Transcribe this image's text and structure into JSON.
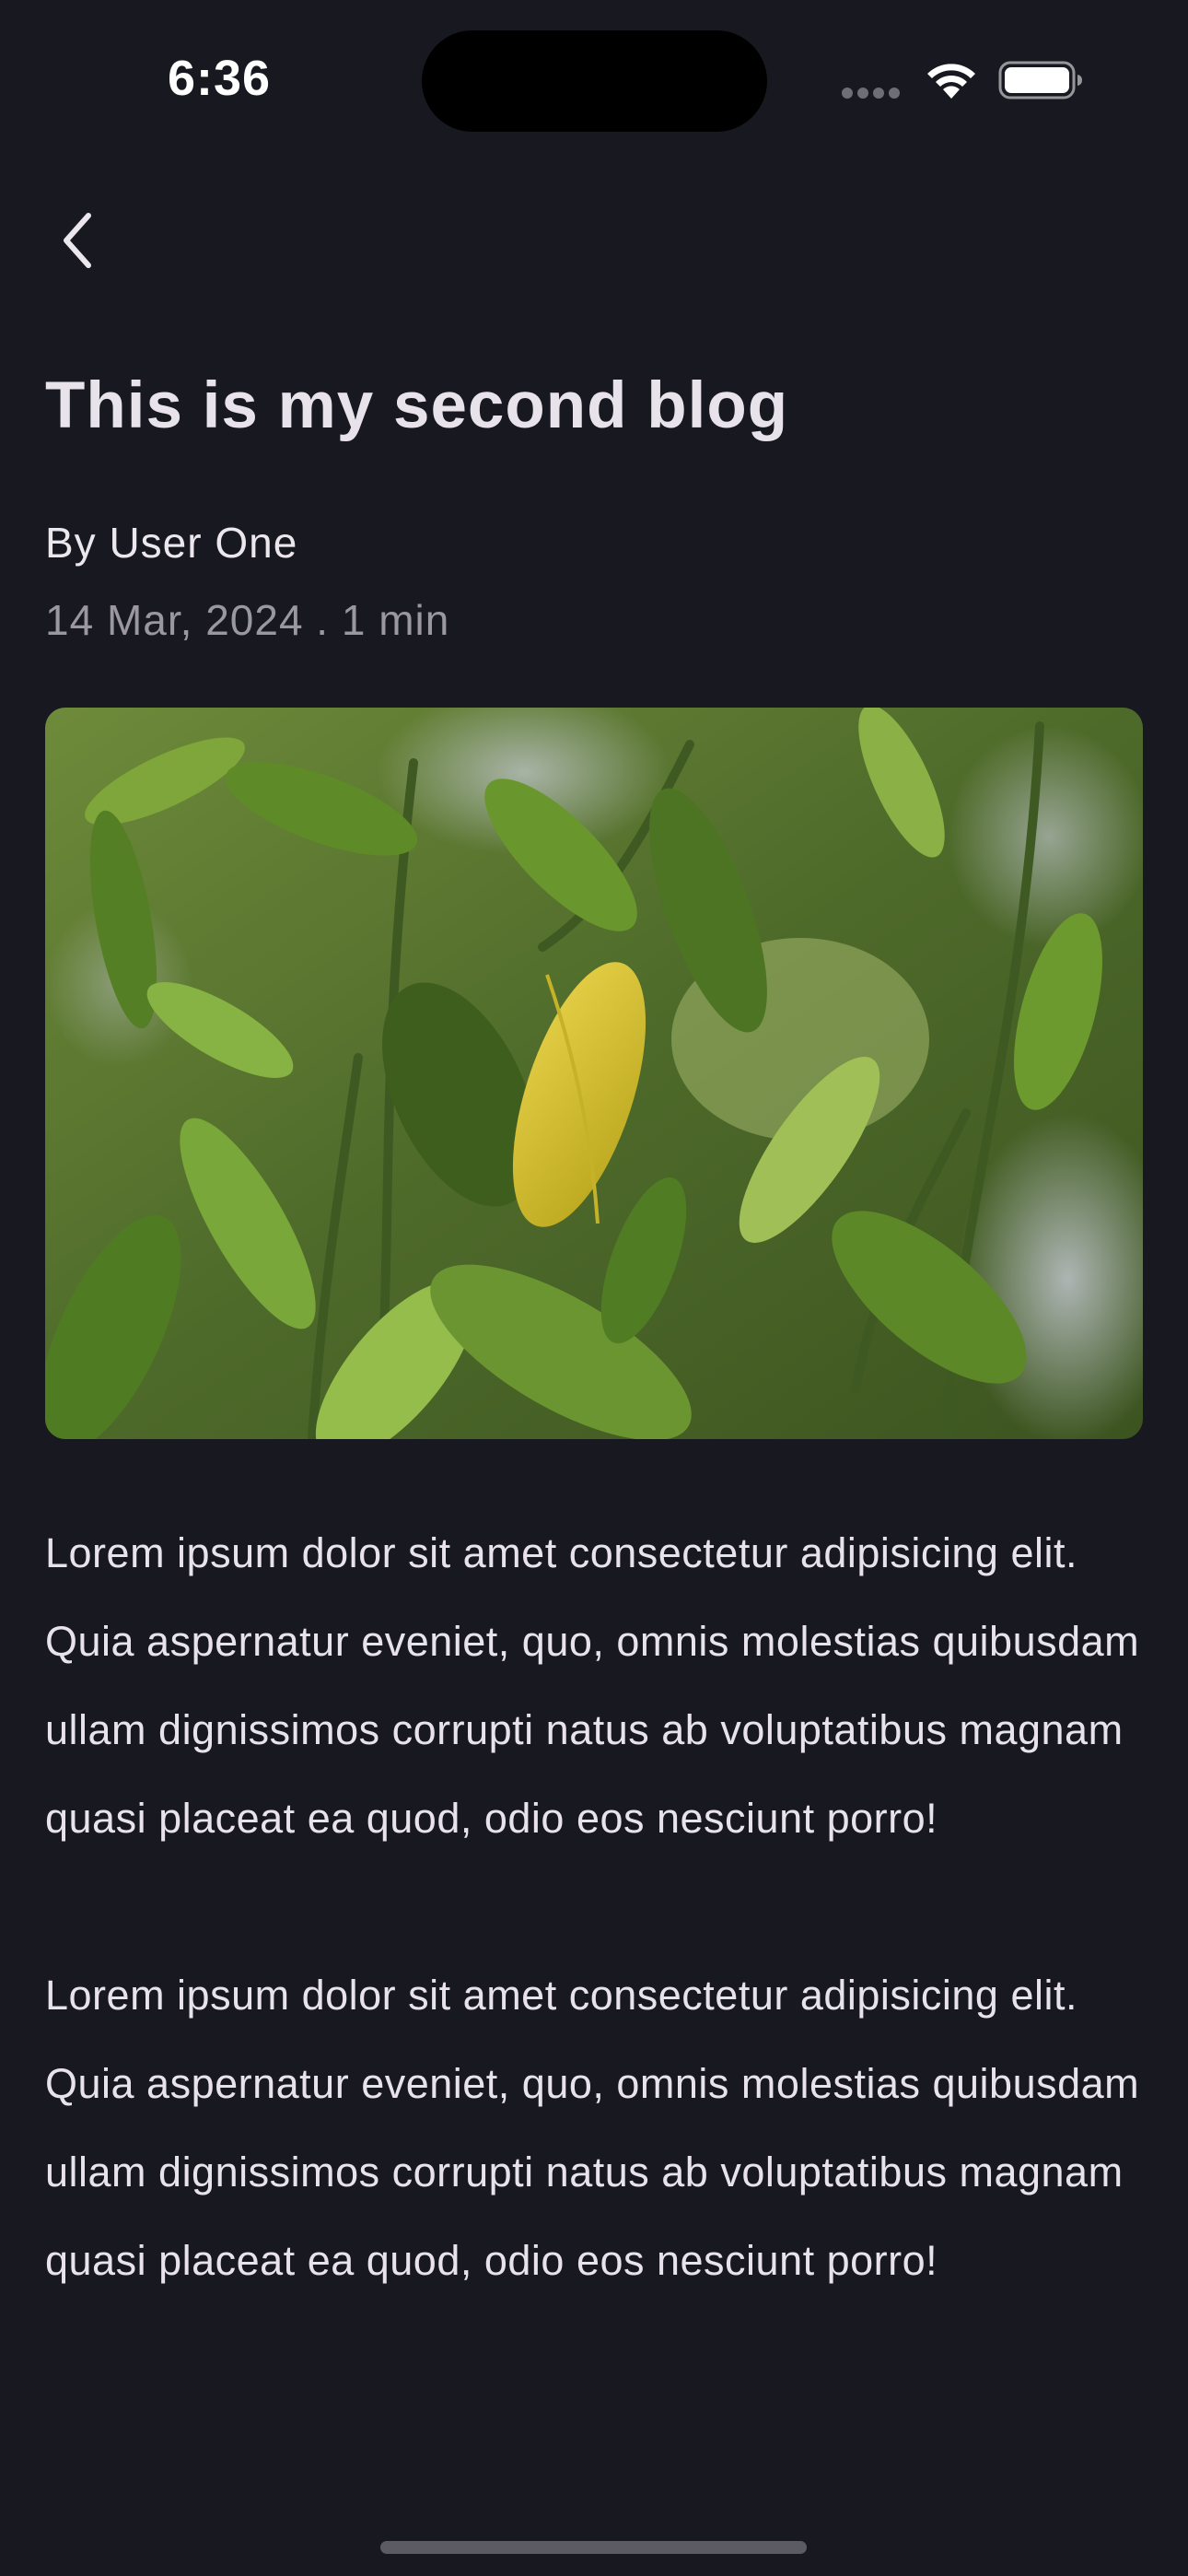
{
  "status_bar": {
    "time": "6:36",
    "wifi_icon": "wifi-icon",
    "battery_icon": "battery-full-icon"
  },
  "nav": {
    "back_icon": "chevron-left-icon"
  },
  "blog": {
    "title": "This is my second blog",
    "author": "By User One",
    "meta": "14 Mar, 2024 . 1 min",
    "image": "plant-leaves-photo",
    "paragraphs": [
      "Lorem ipsum dolor sit amet consectetur adipisicing elit. Quia aspernatur eveniet, quo, omnis molestias quibusdam ullam dignissimos corrupti natus ab voluptatibus magnam quasi placeat ea quod, odio eos nesciunt porro!",
      "Lorem ipsum dolor sit amet consectetur adipisicing elit. Quia aspernatur eveniet, quo, omnis molestias quibusdam ullam dignissimos corrupti natus ab voluptatibus magnam quasi placeat ea quod, odio eos nesciunt porro!"
    ]
  },
  "colors": {
    "background": "#181820",
    "text_primary": "#ECE7EC",
    "text_secondary": "#9A979E"
  }
}
